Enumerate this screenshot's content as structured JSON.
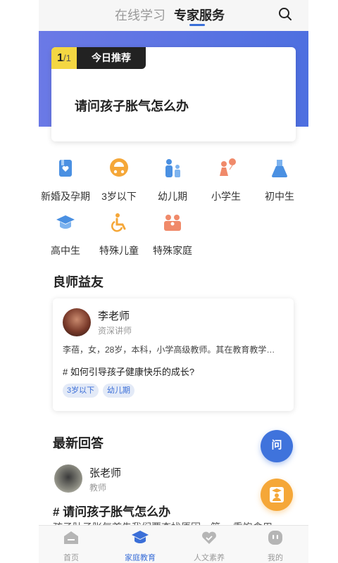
{
  "header": {
    "tabs": [
      {
        "label": "在线学习",
        "active": false
      },
      {
        "label": "专家服务",
        "active": true
      }
    ]
  },
  "recommend": {
    "count_current": "1",
    "count_total": "/1",
    "tag": "今日推荐",
    "title": "请问孩子胀气怎么办"
  },
  "categories": [
    {
      "label": "新婚及孕期",
      "icon": "book-heart-icon"
    },
    {
      "label": "3岁以下",
      "icon": "stroller-icon"
    },
    {
      "label": "幼儿期",
      "icon": "parent-child-icon"
    },
    {
      "label": "小学生",
      "icon": "child-balloon-icon"
    },
    {
      "label": "初中生",
      "icon": "flask-icon"
    },
    {
      "label": "高中生",
      "icon": "graduation-cap-icon"
    },
    {
      "label": "特殊儿童",
      "icon": "wheelchair-icon"
    },
    {
      "label": "特殊家庭",
      "icon": "family-icon"
    }
  ],
  "teachers_section": {
    "title": "良师益友",
    "card": {
      "name": "李老师",
      "role": "资深讲师",
      "description": "李蓓，女，28岁，本科，小学高级教师。其在教育教学…",
      "question": "# 如何引导孩子健康快乐的成长?",
      "tags": [
        "3岁以下",
        "幼儿期"
      ]
    }
  },
  "answers_section": {
    "title": "最新回答",
    "item": {
      "name": "张老师",
      "role": "教师",
      "question": "# 请问孩子胀气怎么办",
      "preview": "孩子肚子胀气首先我们要查找原因，第…  重饱食用"
    }
  },
  "fab": {
    "ask_label": "问"
  },
  "bottom_nav": [
    {
      "label": "首页",
      "icon": "home-icon",
      "active": false
    },
    {
      "label": "家庭教育",
      "icon": "graduation-cap-icon",
      "active": true
    },
    {
      "label": "人文素养",
      "icon": "heart-icon",
      "active": false
    },
    {
      "label": "我的",
      "icon": "profile-icon",
      "active": false
    }
  ],
  "colors": {
    "accent": "#3b6fd8",
    "banner": "#5a73e3",
    "highlight": "#f4d742",
    "orange": "#f5a738"
  }
}
